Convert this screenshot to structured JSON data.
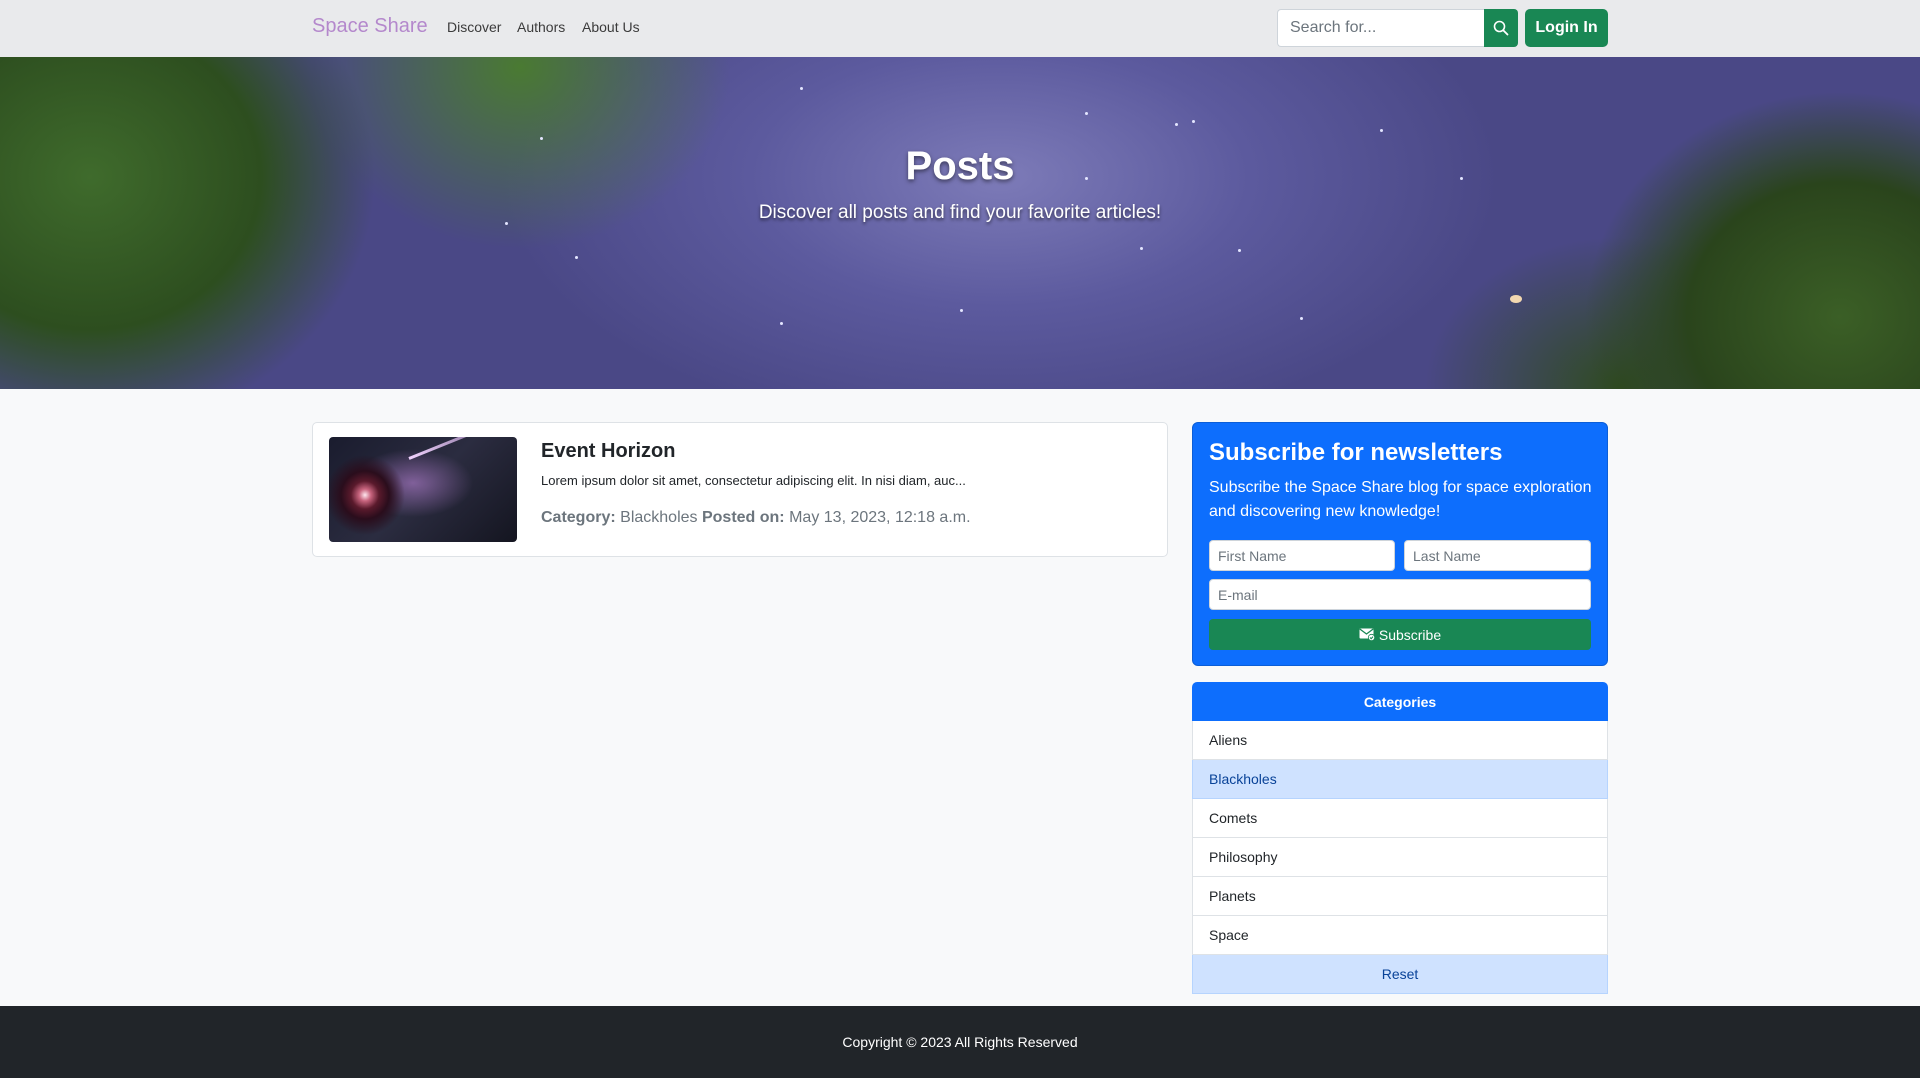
{
  "navbar": {
    "brand": "Space Share",
    "links": [
      "Discover",
      "Authors",
      "About Us"
    ],
    "search_placeholder": "Search for...",
    "search_icon": "search-icon",
    "login_label": "Login In"
  },
  "hero": {
    "title": "Posts",
    "subtitle": "Discover all posts and find your favorite articles!"
  },
  "posts": [
    {
      "title": "Event Horizon",
      "excerpt": "Lorem ipsum dolor sit amet, consectetur adipiscing elit. In nisi diam, auc...",
      "category_label": "Category:",
      "category": "Blackholes",
      "posted_label": "Posted on:",
      "posted_on": "May 13, 2023, 12:18 a.m."
    }
  ],
  "newsletter": {
    "title": "Subscribe for newsletters",
    "text": "Subscribe the Space Share blog for space exploration and discovering new knowledge!",
    "first_name_placeholder": "First Name",
    "last_name_placeholder": "Last Name",
    "email_placeholder": "E-mail",
    "subscribe_label": "Subscribe",
    "subscribe_icon": "envelope-check-icon"
  },
  "categories": {
    "header": "Categories",
    "items": [
      "Aliens",
      "Blackholes",
      "Comets",
      "Philosophy",
      "Planets",
      "Space"
    ],
    "active": "Blackholes",
    "reset_label": "Reset"
  },
  "footer": {
    "copyright": "Copyright © 2023 All Rights Reserved"
  },
  "colors": {
    "primary": "#0d6efd",
    "success": "#198754",
    "brand": "#b488cc",
    "footer_bg": "#212529",
    "active_item_bg": "#cfe2ff"
  }
}
